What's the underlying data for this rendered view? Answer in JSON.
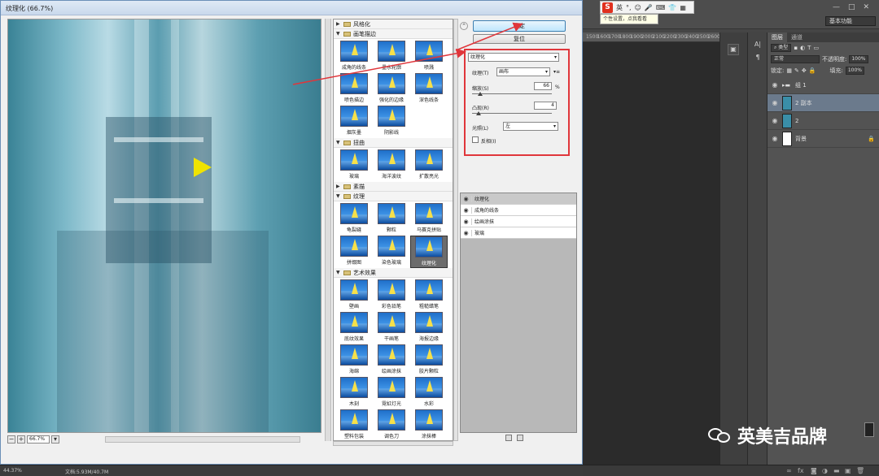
{
  "dialog": {
    "title": "纹理化 (66.7%)",
    "zoom_value": "66.7%",
    "ok_label": "确定",
    "reset_label": "复位"
  },
  "filter_categories": [
    {
      "name": "风格化",
      "expanded": false,
      "filters": []
    },
    {
      "name": "画笔描边",
      "expanded": true,
      "filters": [
        "成角的线条",
        "墨水轮廓",
        "喷溅",
        "喷色描边",
        "强化的边缘",
        "深色线条",
        "烟灰墨",
        "阴影线"
      ]
    },
    {
      "name": "扭曲",
      "expanded": true,
      "filters": [
        "玻璃",
        "海洋波纹",
        "扩散亮光"
      ]
    },
    {
      "name": "素描",
      "expanded": false,
      "filters": []
    },
    {
      "name": "纹理",
      "expanded": true,
      "filters": [
        "龟裂缝",
        "颗粒",
        "马赛克拼贴",
        "拼缀图",
        "染色玻璃",
        "纹理化"
      ]
    },
    {
      "name": "艺术效果",
      "expanded": true,
      "filters": [
        "壁画",
        "彩色铅笔",
        "粗糙蜡笔",
        "底纹效果",
        "干画笔",
        "海报边缘",
        "海绵",
        "绘画涂抹",
        "胶片颗粒",
        "木刻",
        "霓虹灯光",
        "水彩",
        "塑料包装",
        "调色刀",
        "涂抹棒"
      ]
    }
  ],
  "selected_filter": "纹理化",
  "settings": {
    "filter_select": "纹理化",
    "texture_label": "纹理(T)",
    "texture_value": "画布",
    "scale_label": "缩放(S)",
    "scale_value": "66",
    "scale_unit": "%",
    "scale_fraction": 0.1,
    "relief_label": "凸现(R)",
    "relief_value": "4",
    "relief_fraction": 0.08,
    "light_label": "光照(L)",
    "light_value": "左",
    "invert_label": "反相(I)",
    "invert_checked": false
  },
  "applied_filters": [
    {
      "name": "纹理化",
      "active": true
    },
    {
      "name": "成角的线条",
      "active": false
    },
    {
      "name": "绘画涂抹",
      "active": false
    },
    {
      "name": "玻璃",
      "active": false
    }
  ],
  "status": {
    "zoom": "44.37%",
    "doc": "文档:5.93M/40.7M"
  },
  "ime": {
    "logo": "S",
    "label": "英",
    "tip": "个性设置，点我看看"
  },
  "workspace": "基本功能",
  "ruler_ticks": [
    "1500",
    "1600",
    "1700",
    "1800",
    "1900",
    "2000",
    "2100",
    "2200",
    "2300",
    "2400",
    "2500",
    "2600"
  ],
  "layers_panel": {
    "tabs": [
      "图层",
      "通道"
    ],
    "filter_kind": "类型",
    "blend_mode": "正常",
    "opacity_label": "不透明度:",
    "opacity_value": "100%",
    "lock_label": "锁定:",
    "fill_label": "填充:",
    "fill_value": "100%",
    "layers": [
      {
        "name": "组 1",
        "type": "group",
        "selected": false
      },
      {
        "name": "2 副本",
        "type": "image",
        "selected": true
      },
      {
        "name": "2",
        "type": "image",
        "selected": false
      },
      {
        "name": "背景",
        "type": "background",
        "selected": false
      }
    ]
  },
  "watermark": "英美吉品牌",
  "colors": {
    "annotation_red": "#e0363b",
    "ok_button_border": "#3c7fb1",
    "selected_layer": "#6b7a8c"
  }
}
